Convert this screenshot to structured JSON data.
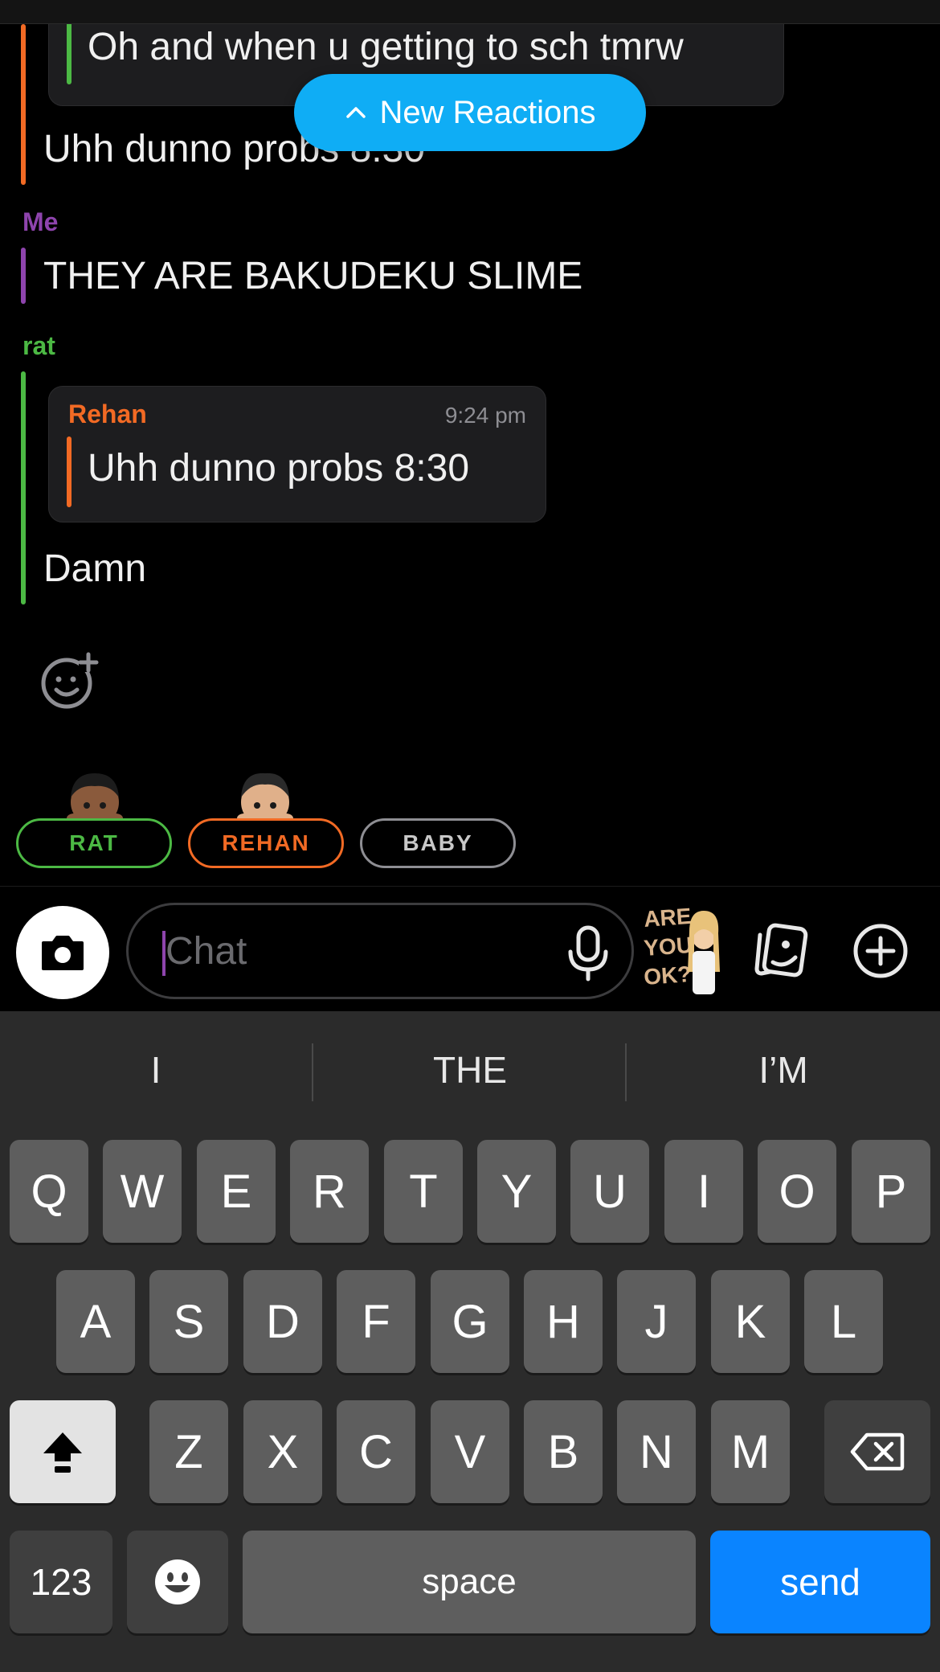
{
  "new_reactions": {
    "label": "New Reactions"
  },
  "messages": {
    "partial_quote_text": "Oh and when u getting to sch tmrw",
    "rehan_reply": "Uhh dunno probs 8:30",
    "me_sender": "Me",
    "me_text": "THEY ARE BAKUDEKU SLIME",
    "rat_sender": "rat",
    "rat_quote": {
      "sender": "Rehan",
      "time": "9:24 pm",
      "text": "Uhh dunno probs 8:30"
    },
    "rat_text": "Damn"
  },
  "participants": [
    "RAT",
    "REHAN",
    "BABY"
  ],
  "input": {
    "placeholder": "Chat"
  },
  "sticker": {
    "lines": [
      "ARE",
      "YOU",
      "OK?"
    ]
  },
  "suggestions": [
    "I",
    "THE",
    "I’M"
  ],
  "keyboard": {
    "row1": [
      "Q",
      "W",
      "E",
      "R",
      "T",
      "Y",
      "U",
      "I",
      "O",
      "P"
    ],
    "row2": [
      "A",
      "S",
      "D",
      "F",
      "G",
      "H",
      "J",
      "K",
      "L"
    ],
    "row3": [
      "Z",
      "X",
      "C",
      "V",
      "B",
      "N",
      "M"
    ],
    "numbers_label": "123",
    "space_label": "space",
    "send_label": "send"
  },
  "colors": {
    "me": "#8e44ad",
    "rat": "#4cb944",
    "rehan": "#f26a24",
    "accent": "#0fadf5",
    "send": "#0a84ff"
  }
}
